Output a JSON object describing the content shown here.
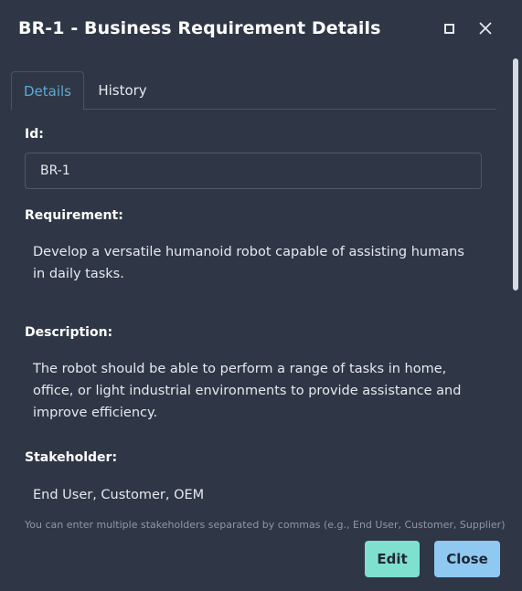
{
  "dialog": {
    "title": "BR-1 - Business Requirement Details",
    "maximize_icon": "maximize-icon",
    "close_icon": "close-icon"
  },
  "tabs": [
    {
      "label": "Details",
      "active": true
    },
    {
      "label": "History",
      "active": false
    }
  ],
  "fields": {
    "id_label": "Id:",
    "id_value": "BR-1",
    "requirement_label": "Requirement:",
    "requirement_value": "Develop a versatile humanoid robot capable of assisting humans in daily tasks.",
    "description_label": "Description:",
    "description_value": "The robot should be able to perform a range of tasks in home, office, or light industrial environments to provide assistance and improve efficiency.",
    "stakeholder_label": "Stakeholder:",
    "stakeholder_value": "End User, Customer, OEM",
    "stakeholder_hint": "You can enter multiple stakeholders separated by commas (e.g., End User, Customer, Supplier)"
  },
  "footer": {
    "edit_label": "Edit",
    "close_label": "Close"
  },
  "colors": {
    "background": "#2f3746",
    "active_tab": "#5ea9d6",
    "edit_button": "#7fe0cf",
    "close_button": "#8fc9f2"
  }
}
